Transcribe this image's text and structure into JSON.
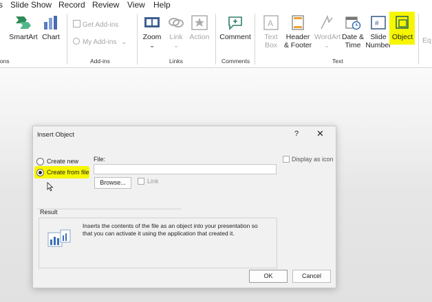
{
  "menu": [
    "s",
    "Slide Show",
    "Record",
    "Review",
    "View",
    "Help"
  ],
  "ribbon": {
    "insert_group": {
      "smartart": "SmartArt",
      "chart": "Chart",
      "label": "ions"
    },
    "addins": {
      "get": "Get Add-ins",
      "my": "My Add-ins",
      "label": "Add-ins"
    },
    "links": {
      "zoom": "Zoom",
      "link": "Link",
      "action": "Action",
      "label": "Links"
    },
    "comments": {
      "comment": "Comment",
      "label": "Comments"
    },
    "text": {
      "textbox_1": "Text",
      "textbox_2": "Box",
      "header_1": "Header",
      "header_2": "& Footer",
      "wordart": "WordArt",
      "datetime_1": "Date &",
      "datetime_2": "Time",
      "slidenum_1": "Slide",
      "slidenum_2": "Number",
      "object": "Object",
      "label": "Text"
    },
    "edge": "Eq"
  },
  "dialog": {
    "title": "Insert Object",
    "help": "?",
    "close": "✕",
    "create_new": "Create new",
    "create_from_file": "Create from file",
    "file_label": "File:",
    "file_value": "",
    "browse": "Browse...",
    "link": "Link",
    "display_as_icon": "Display as icon",
    "result_label": "Result",
    "result_text_1": "Inserts the contents of the file as an object into your presentation so",
    "result_text_2": "that you can activate it using the application that created it.",
    "ok": "OK",
    "cancel": "Cancel"
  },
  "colors": {
    "highlight": "#f6f600",
    "accent": "#2e7d6b",
    "icon_blue": "#3a6fb5"
  }
}
